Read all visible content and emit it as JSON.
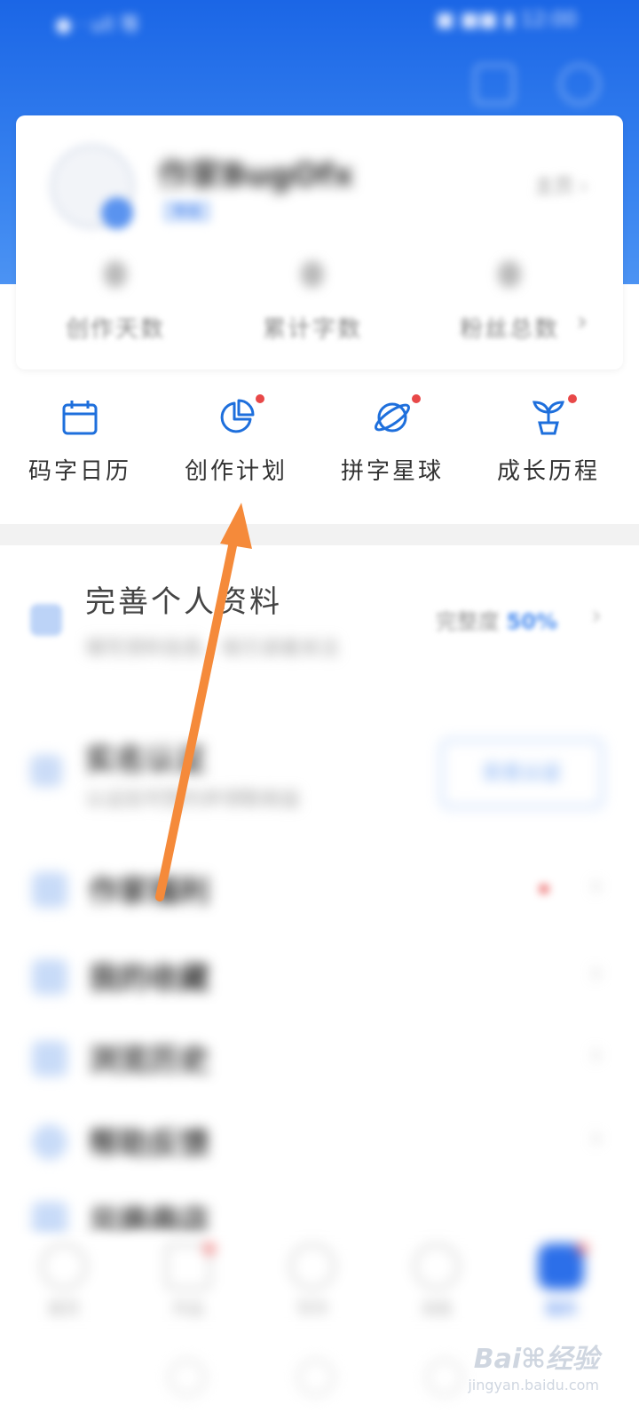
{
  "status_bar": {
    "left": "● · ull 等",
    "right": "■ ■■ ▮ 12:00"
  },
  "profile": {
    "name": "作家BugOfx",
    "level": "等级",
    "home_link": "主页 ›"
  },
  "stats": [
    {
      "value": "0",
      "label": "创作天数"
    },
    {
      "value": "0",
      "label": "累计字数"
    },
    {
      "value": "0",
      "label": "粉丝总数"
    }
  ],
  "shortcuts": [
    {
      "label": "码字日历",
      "icon": "calendar-icon",
      "has_dot": false
    },
    {
      "label": "创作计划",
      "icon": "pie-chart-icon",
      "has_dot": true
    },
    {
      "label": "拼字星球",
      "icon": "planet-icon",
      "has_dot": true
    },
    {
      "label": "成长历程",
      "icon": "sprout-icon",
      "has_dot": true
    }
  ],
  "profile_complete": {
    "title": "完善个人资料",
    "subtitle": "填写资料信息，吸引读者关注",
    "completion_label": "完整度",
    "completion_value": "50%"
  },
  "verify": {
    "title": "实名认证",
    "subtitle": "认证后可签约并领取收益",
    "button": "实名认证"
  },
  "menu_items": [
    {
      "label": "作家福利"
    },
    {
      "label": "我的收藏"
    },
    {
      "label": "浏览历史"
    },
    {
      "label": "帮助反馈"
    },
    {
      "label": "兑换商店"
    }
  ],
  "bottom_nav": [
    {
      "label": "首页"
    },
    {
      "label": "作品"
    },
    {
      "label": "写作"
    },
    {
      "label": "消息"
    },
    {
      "label": "我的"
    }
  ],
  "watermark": {
    "text": "Bai⌘经验",
    "sub": "jingyan.baidu.com"
  },
  "colors": {
    "brand": "#1b66e6",
    "arrow": "#f58a3a",
    "dot": "#e84848"
  }
}
